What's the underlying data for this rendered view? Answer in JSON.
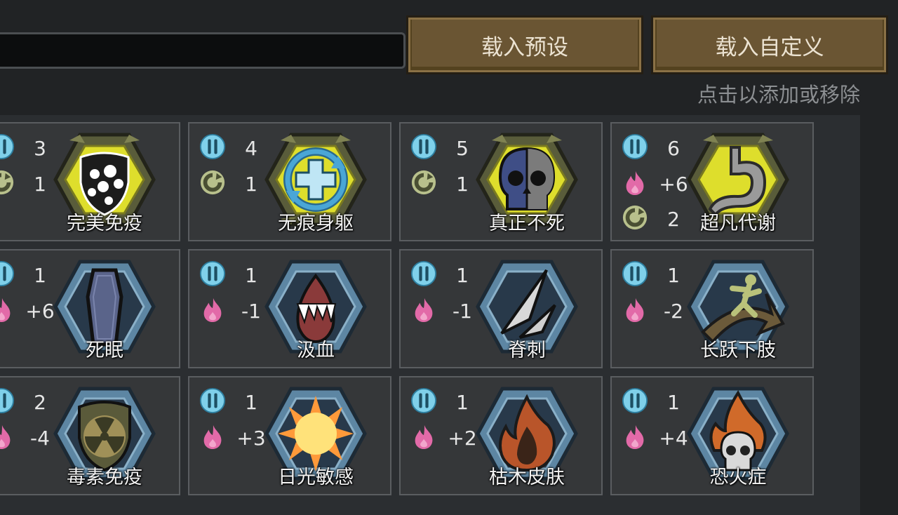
{
  "search": {
    "value": "",
    "placeholder": ""
  },
  "buttons": {
    "preset": "载入预设",
    "custom": "载入自定义"
  },
  "hint": "点击以添加或移除",
  "stat_icons": {
    "cost": "power-cost-icon",
    "complexity": "cycle-complexity-icon",
    "fire": "flame-icon"
  },
  "cards": [
    {
      "name": "完美免疫",
      "icon": "shield-dots-icon",
      "frame": "gold",
      "stats": [
        {
          "type": "cost",
          "value": "3"
        },
        {
          "type": "complexity",
          "value": "1"
        }
      ]
    },
    {
      "name": "无痕身躯",
      "icon": "regeneration-icon",
      "frame": "gold",
      "stats": [
        {
          "type": "cost",
          "value": "4"
        },
        {
          "type": "complexity",
          "value": "1"
        }
      ]
    },
    {
      "name": "真正不死",
      "icon": "skull-icon",
      "frame": "gold",
      "stats": [
        {
          "type": "cost",
          "value": "5"
        },
        {
          "type": "complexity",
          "value": "1"
        }
      ]
    },
    {
      "name": "超凡代谢",
      "icon": "stomach-icon",
      "frame": "gold",
      "stats": [
        {
          "type": "cost",
          "value": "6"
        },
        {
          "type": "fire",
          "value": "+6"
        },
        {
          "type": "complexity",
          "value": "2"
        }
      ]
    },
    {
      "name": "死眠",
      "icon": "coffin-icon",
      "frame": "blue",
      "stats": [
        {
          "type": "cost",
          "value": "1"
        },
        {
          "type": "fire",
          "value": "+6"
        }
      ]
    },
    {
      "name": "汲血",
      "icon": "fangs-icon",
      "frame": "blue",
      "stats": [
        {
          "type": "cost",
          "value": "1"
        },
        {
          "type": "fire",
          "value": "-1"
        }
      ]
    },
    {
      "name": "脊刺",
      "icon": "spikes-icon",
      "frame": "blue",
      "stats": [
        {
          "type": "cost",
          "value": "1"
        },
        {
          "type": "fire",
          "value": "-1"
        }
      ]
    },
    {
      "name": "长跃下肢",
      "icon": "leap-icon",
      "frame": "blue",
      "stats": [
        {
          "type": "cost",
          "value": "1"
        },
        {
          "type": "fire",
          "value": "-2"
        }
      ]
    },
    {
      "name": "毒素免疫",
      "icon": "radiation-shield-icon",
      "frame": "blue",
      "stats": [
        {
          "type": "cost",
          "value": "2"
        },
        {
          "type": "fire",
          "value": "-4"
        }
      ]
    },
    {
      "name": "日光敏感",
      "icon": "sun-icon",
      "frame": "blue",
      "stats": [
        {
          "type": "cost",
          "value": "1"
        },
        {
          "type": "fire",
          "value": "+3"
        }
      ]
    },
    {
      "name": "枯木皮肤",
      "icon": "fire-icon",
      "frame": "blue",
      "stats": [
        {
          "type": "cost",
          "value": "1"
        },
        {
          "type": "fire",
          "value": "+2"
        }
      ]
    },
    {
      "name": "恐火症",
      "icon": "flaming-skull-icon",
      "frame": "blue",
      "stats": [
        {
          "type": "cost",
          "value": "1"
        },
        {
          "type": "fire",
          "value": "+4"
        }
      ]
    }
  ]
}
